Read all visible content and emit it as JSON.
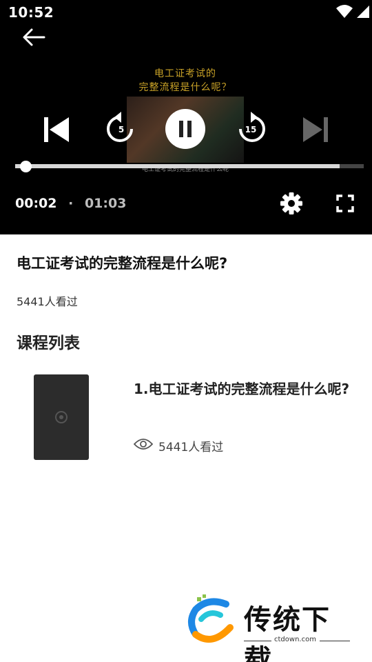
{
  "status": {
    "time": "10:52"
  },
  "video": {
    "caption_line1": "电工证考试的",
    "caption_line2": "完整流程是什么呢？",
    "subtitle": "电工证考试的完整流程是什么呢",
    "rewind_seconds": "5",
    "forward_seconds": "15",
    "current_time": "00:02",
    "separator": "·",
    "duration": "01:03",
    "progress_fraction": 0.03,
    "buffered_fraction": 0.93
  },
  "icons": {
    "back": "arrow-left-icon",
    "prev": "skip-previous-icon",
    "rewind": "replay-5-icon",
    "play_pause": "pause-icon",
    "forward": "forward-15-icon",
    "next": "skip-next-icon",
    "settings": "gear-icon",
    "fullscreen": "fullscreen-icon",
    "views": "eye-icon"
  },
  "detail": {
    "title": "电工证考试的完整流程是什么呢?",
    "views": "5441人看过",
    "section_title": "课程列表"
  },
  "course_list": [
    {
      "title": "1.电工证考试的完整流程是什么呢?",
      "views": "5441人看过"
    }
  ],
  "watermark": {
    "brand": "传统下载",
    "url": "ctdown.com"
  }
}
